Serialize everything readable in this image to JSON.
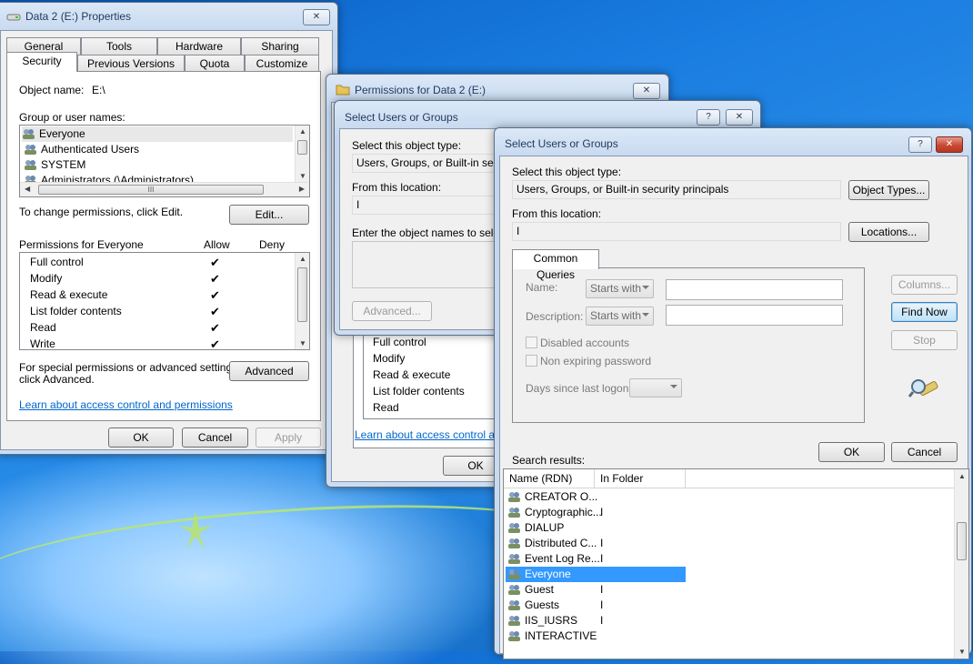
{
  "props": {
    "title": "Data 2 (E:) Properties",
    "tabs_top": [
      "General",
      "Tools",
      "Hardware",
      "Sharing"
    ],
    "tabs_bottom": [
      "Security",
      "Previous Versions",
      "Quota",
      "Customize"
    ],
    "object_name_label": "Object name:",
    "object_name_value": "E:\\",
    "group_label": "Group or user names:",
    "groups": [
      "Everyone",
      "Authenticated Users",
      "SYSTEM",
      "Administrators (\\Administrators)"
    ],
    "hscroll_grip": "III",
    "change_text": "To change permissions, click Edit.",
    "edit_label": "Edit...",
    "perm_for_label": "Permissions for Everyone",
    "allow_label": "Allow",
    "deny_label": "Deny",
    "perms": [
      "Full control",
      "Modify",
      "Read & execute",
      "List folder contents",
      "Read",
      "Write"
    ],
    "check_glyph": "✔",
    "special_text_1": "For special permissions or advanced settings,",
    "special_text_2": "click Advanced.",
    "advanced_label": "Advanced",
    "learn_link": "Learn about access control and permissions",
    "ok_label": "OK",
    "cancel_label": "Cancel",
    "apply_label": "Apply"
  },
  "permwin": {
    "title": "Permissions for Data 2 (E:)",
    "perms": [
      "Full control",
      "Modify",
      "Read & execute",
      "List folder contents",
      "Read"
    ],
    "learn_link": "Learn about access control and p",
    "ok_label": "OK"
  },
  "sel1": {
    "title": "Select Users or Groups",
    "object_type_label": "Select this object type:",
    "object_type_value": "Users, Groups, or Built-in security",
    "location_label": "From this location:",
    "location_value": "I",
    "enter_label": "Enter the object names to select (",
    "advanced_label": "Advanced..."
  },
  "sel2": {
    "title": "Select Users or Groups",
    "help_glyph": "?",
    "close_glyph": "✕",
    "object_type_label": "Select this object type:",
    "object_type_value": "Users, Groups, or Built-in security principals",
    "object_types_btn": "Object Types...",
    "location_label": "From this location:",
    "location_value": "I",
    "locations_btn": "Locations...",
    "tab_label": "Common Queries",
    "name_label": "Name:",
    "description_label": "Description:",
    "starts_with": "Starts with",
    "disabled_accounts": "Disabled accounts",
    "non_expiring": "Non expiring password",
    "days_label": "Days since last logon:",
    "columns_btn": "Columns...",
    "find_now_btn": "Find Now",
    "stop_btn": "Stop",
    "ok_label": "OK",
    "cancel_label": "Cancel",
    "search_results_label": "Search results:",
    "col_name": "Name (RDN)",
    "col_folder": "In Folder",
    "results": [
      {
        "name": "CREATOR O...",
        "folder": ""
      },
      {
        "name": "Cryptographic...",
        "folder": "I"
      },
      {
        "name": "DIALUP",
        "folder": ""
      },
      {
        "name": "Distributed C...",
        "folder": "I"
      },
      {
        "name": "Event Log Re...",
        "folder": "I"
      },
      {
        "name": "Everyone",
        "folder": ""
      },
      {
        "name": "Guest",
        "folder": "I"
      },
      {
        "name": "Guests",
        "folder": "I"
      },
      {
        "name": "IIS_IUSRS",
        "folder": "I"
      },
      {
        "name": "INTERACTIVE",
        "folder": ""
      }
    ],
    "selected_result": "Everyone"
  },
  "colors": {
    "selection": "#3399ff",
    "link": "#0066cc",
    "title_text": "#1e395b"
  }
}
